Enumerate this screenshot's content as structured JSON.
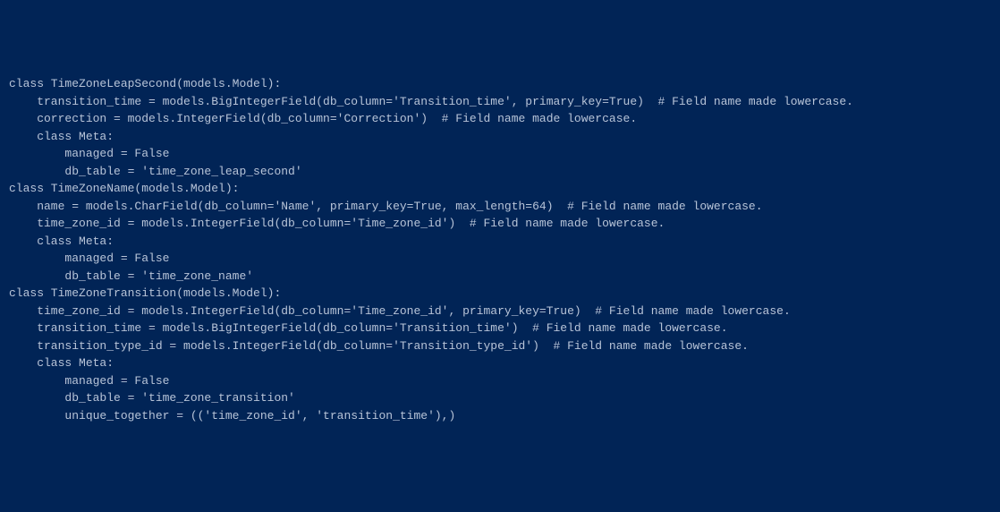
{
  "code": {
    "line01": "class TimeZoneLeapSecond(models.Model):",
    "line02": "    transition_time = models.BigIntegerField(db_column='Transition_time', primary_key=True)  # Field name made lowercase.",
    "line03": "    correction = models.IntegerField(db_column='Correction')  # Field name made lowercase.",
    "line04": "",
    "line05": "    class Meta:",
    "line06": "        managed = False",
    "line07": "        db_table = 'time_zone_leap_second'",
    "line08": "",
    "line09": "",
    "line10": "class TimeZoneName(models.Model):",
    "line11": "    name = models.CharField(db_column='Name', primary_key=True, max_length=64)  # Field name made lowercase.",
    "line12": "    time_zone_id = models.IntegerField(db_column='Time_zone_id')  # Field name made lowercase.",
    "line13": "",
    "line14": "    class Meta:",
    "line15": "        managed = False",
    "line16": "        db_table = 'time_zone_name'",
    "line17": "",
    "line18": "",
    "line19": "class TimeZoneTransition(models.Model):",
    "line20": "    time_zone_id = models.IntegerField(db_column='Time_zone_id', primary_key=True)  # Field name made lowercase.",
    "line21": "    transition_time = models.BigIntegerField(db_column='Transition_time')  # Field name made lowercase.",
    "line22": "    transition_type_id = models.IntegerField(db_column='Transition_type_id')  # Field name made lowercase.",
    "line23": "",
    "line24": "    class Meta:",
    "line25": "        managed = False",
    "line26": "        db_table = 'time_zone_transition'",
    "line27": "        unique_together = (('time_zone_id', 'transition_time'),)"
  }
}
